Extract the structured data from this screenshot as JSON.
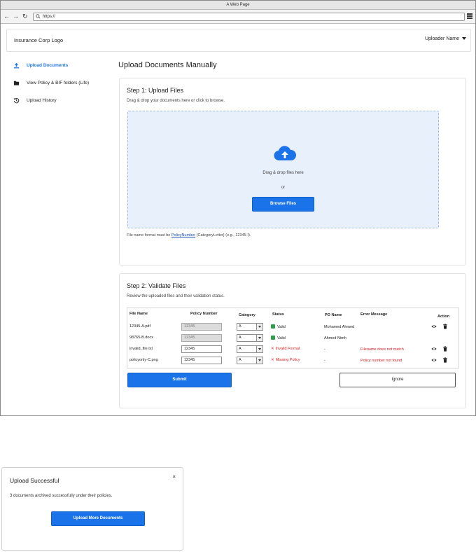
{
  "browser": {
    "title": "A Web Page",
    "url": "https://"
  },
  "header": {
    "logo": "Insurance Corp Logo",
    "user": "Uploader Name"
  },
  "sidebar": {
    "items": [
      {
        "label": "Upload Documents",
        "icon": "upload-icon"
      },
      {
        "label": "View Policy & BIF folders (Life)",
        "icon": "folder-icon"
      },
      {
        "label": "Upload History",
        "icon": "history-icon"
      }
    ]
  },
  "main": {
    "title": "Upload Documents Manually",
    "step1": {
      "title": "Step 1: Upload Files",
      "desc": "Drag & drop your documents here or click to browse.",
      "drop_text": "Drag & drop files here",
      "or": "or",
      "browse": "Browse Files",
      "hint_pre": "File name format must be ",
      "hint_link": "PolicyNumber",
      "hint_post": "{CategoryLetter} (e.g., 12345-I)."
    },
    "step2": {
      "title": "Step 2: Validate Files",
      "desc": "Review the uploaded files and their validation status.",
      "columns": {
        "file": "File Name",
        "policy": "Policy Number",
        "category": "Category",
        "status": "Status",
        "po": "PO Name",
        "error": "Error Message",
        "action": "Action"
      },
      "rows": [
        {
          "file": "12345-A.pdf",
          "policy": "12345",
          "category": "A",
          "status": "Valid",
          "po": "Mohamed Ahmed",
          "error": ""
        },
        {
          "file": "98765-B.docx",
          "policy": "12345",
          "category": "A",
          "status": "Valid",
          "po": "Ahmed Nimh",
          "error": ""
        },
        {
          "file": "invalid_file.txt",
          "policy": "12345",
          "category": "A",
          "status": "Invalid Format",
          "po": "-",
          "error": "Filename does not match"
        },
        {
          "file": "policyonly-C.png",
          "policy": "12345",
          "category": "A",
          "status": "Missing Policy",
          "po": "-",
          "error": "Policy number not found"
        }
      ],
      "submit": "Submit",
      "ignore": "Ignore"
    }
  },
  "modal": {
    "title": "Upload Successful",
    "close": "×",
    "message": "3 documents archived successfully under their policies.",
    "button": "Upload More Documents"
  },
  "colors": {
    "primary": "#1a73e8",
    "valid": "#2e9d48",
    "error": "#d32020",
    "dropzone": "#e8f0fc"
  }
}
